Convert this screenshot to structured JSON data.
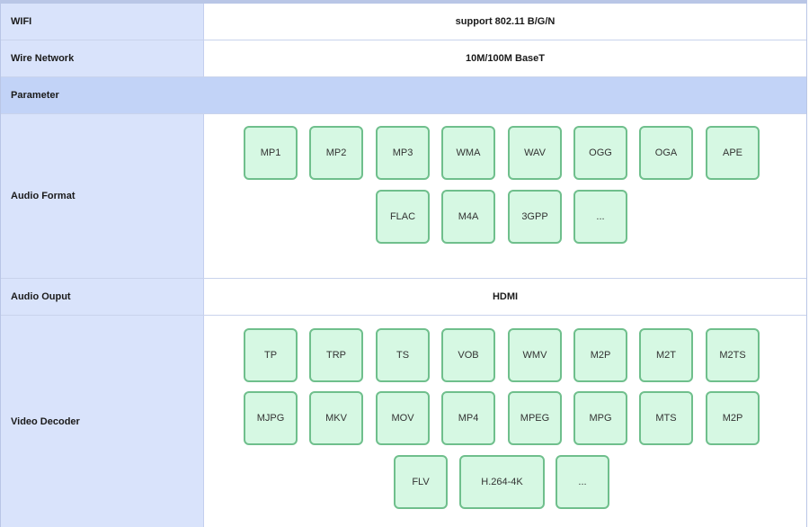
{
  "rows": {
    "wifi": {
      "label": "WIFI",
      "value": "support 802.11 B/G/N"
    },
    "wire": {
      "label": "Wire Network",
      "value": "10M/100M BaseT"
    },
    "param": {
      "label": "Parameter"
    },
    "audio_format": {
      "label": "Audio Format",
      "formats": [
        "MP1",
        "MP2",
        "MP3",
        "WMA",
        "WAV",
        "OGG",
        "OGA",
        "APE",
        "FLAC",
        "M4A",
        "3GPP",
        "..."
      ]
    },
    "audio_output": {
      "label": "Audio Ouput",
      "value": "HDMI"
    },
    "video_decoder": {
      "label": "Video Decoder",
      "formats": [
        "TP",
        "TRP",
        "TS",
        "VOB",
        "WMV",
        "M2P",
        "M2T",
        "M2TS",
        "MJPG",
        "MKV",
        "MOV",
        "MP4",
        "MPEG",
        "MPG",
        "MTS",
        "M2P",
        "FLV",
        "H.264-4K",
        "..."
      ]
    }
  },
  "colors": {
    "label_bg": "#d9e3fb",
    "header_bg": "#c2d3f7",
    "chip_bg": "#d6f8e3",
    "chip_border": "#6fbf8c"
  }
}
